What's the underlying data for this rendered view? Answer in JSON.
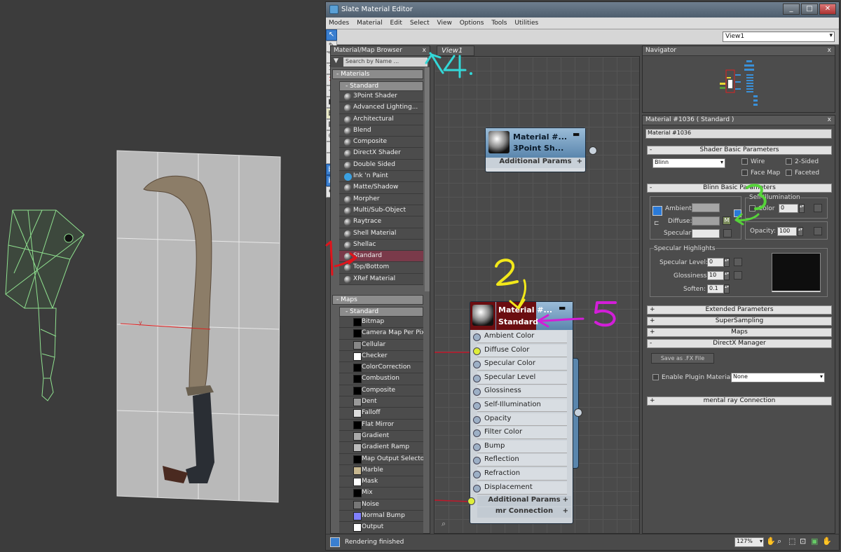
{
  "window": {
    "title": "Slate Material Editor",
    "buttons": [
      "_",
      "□",
      "✕"
    ]
  },
  "menu": [
    "Modes",
    "Material",
    "Edit",
    "Select",
    "View",
    "Options",
    "Tools",
    "Utilities"
  ],
  "view_selector": "View1",
  "browser": {
    "title": "Material/Map Browser",
    "close": "x",
    "search_placeholder": "Search by Name ...",
    "materials_header": "- Materials",
    "materials_sub": "- Standard",
    "materials": [
      "3Point Shader",
      "Advanced Lighting...",
      "Architectural",
      "Blend",
      "Composite",
      "DirectX Shader",
      "Double Sided",
      "Ink 'n Paint",
      "Matte/Shadow",
      "Morpher",
      "Multi/Sub-Object",
      "Raytrace",
      "Shell Material",
      "Shellac",
      "Standard",
      "Top/Bottom",
      "XRef Material"
    ],
    "selected_material": "Standard",
    "maps_header": "- Maps",
    "maps_sub": "- Standard",
    "maps": [
      "Bitmap",
      "Camera Map Per Pixel",
      "Cellular",
      "Checker",
      "ColorCorrection",
      "Combustion",
      "Composite",
      "Dent",
      "Falloff",
      "Flat Mirror",
      "Gradient",
      "Gradient Ramp",
      "Map Output Selector",
      "Marble",
      "Mask",
      "Mix",
      "Noise",
      "Normal Bump",
      "Output"
    ]
  },
  "view_tab": "View1",
  "node1": {
    "title1": "Material #...",
    "title2": "3Point  Sh...",
    "footer": "Additional Params",
    "footer_pm": "+"
  },
  "node2": {
    "title1": "Material #...",
    "title2": "Standard",
    "slots": [
      "Ambient Color",
      "Diffuse Color",
      "Specular Color",
      "Specular Level",
      "Glossiness",
      "Self-Illumination",
      "Opacity",
      "Filter Color",
      "Bump",
      "Reflection",
      "Refraction",
      "Displacement"
    ],
    "footer1": "Additional Params",
    "footer2": "mr Connection"
  },
  "navigator": {
    "title": "Navigator",
    "close": "x"
  },
  "params": {
    "title": "Material #1036  ( Standard )",
    "close": "x",
    "name_value": "Material #1036",
    "rollouts": {
      "shader": "Shader Basic Parameters",
      "blinn": "Blinn Basic Parameters",
      "extended": "Extended Parameters",
      "supersampling": "SuperSampling",
      "maps": "Maps",
      "directx": "DirectX Manager",
      "mental_ray": "mental ray Connection",
      "minus": "-",
      "plus": "+"
    },
    "shader_type": "Blinn",
    "wire": "Wire",
    "two_sided": "2-Sided",
    "face_map": "Face Map",
    "faceted": "Faceted",
    "self_illum": "Self-Illumination",
    "color_label": "Color",
    "color_value": "0",
    "ambient": "Ambient:",
    "diffuse": "Diffuse:",
    "specular": "Specular:",
    "m_button": "M",
    "opacity_label": "Opacity:",
    "opacity_value": "100",
    "spec_highlights": "Specular Highlights",
    "spec_level_label": "Specular Level:",
    "spec_level": "0",
    "gloss_label": "Glossiness:",
    "gloss": "10",
    "soften_label": "Soften:",
    "soften": "0.1",
    "save_fx": "Save as .FX File",
    "enable_plugin": "Enable Plugin Material",
    "plugin_value": "None"
  },
  "status": {
    "text": "Rendering finished",
    "zoom": "127%"
  },
  "annotations": [
    "1",
    "2",
    "3",
    "4.",
    "5"
  ],
  "colors": {
    "node_header": "#5a86ad",
    "selected_item": "#7a3a4a",
    "diffuse_swatch": "#a0a0a0",
    "annotation_red": "#e0141c",
    "annotation_yellow": "#f2e81a",
    "annotation_green": "#56d33a",
    "annotation_cyan": "#33d8d8",
    "annotation_magenta": "#d21ed8"
  }
}
